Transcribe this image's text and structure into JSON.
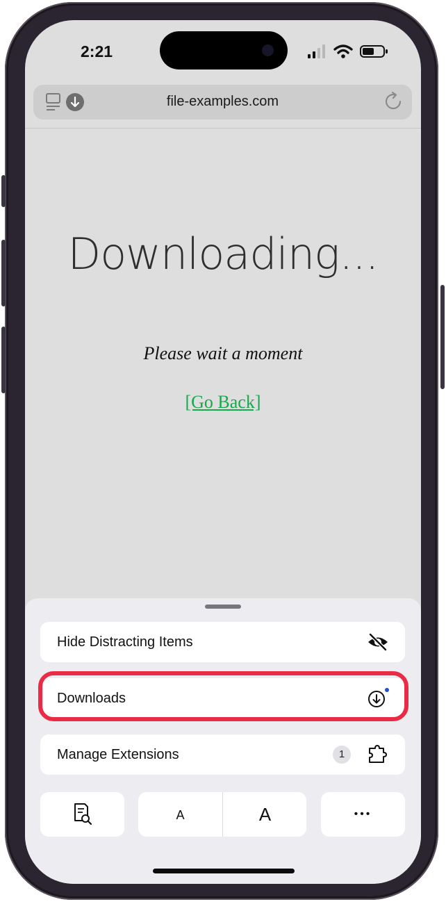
{
  "status_bar": {
    "time": "2:21"
  },
  "address_bar": {
    "url": "file-examples.com"
  },
  "page": {
    "heading": "Downloading...",
    "subtitle": "Please wait a moment",
    "back_link": "[Go Back]"
  },
  "menu": {
    "items": [
      {
        "label": "Hide Distracting Items",
        "icon": "eye-slash-icon"
      },
      {
        "label": "Downloads",
        "icon": "download-circle-icon"
      },
      {
        "label": "Manage Extensions",
        "badge": "1",
        "icon": "puzzle-piece-icon"
      }
    ],
    "toolbar": {
      "small_font": "A",
      "large_font": "A",
      "more": "•••"
    }
  },
  "colors": {
    "highlight": "#ea2b45",
    "link": "#17a84b",
    "notification_dot": "#1e4fd8"
  }
}
